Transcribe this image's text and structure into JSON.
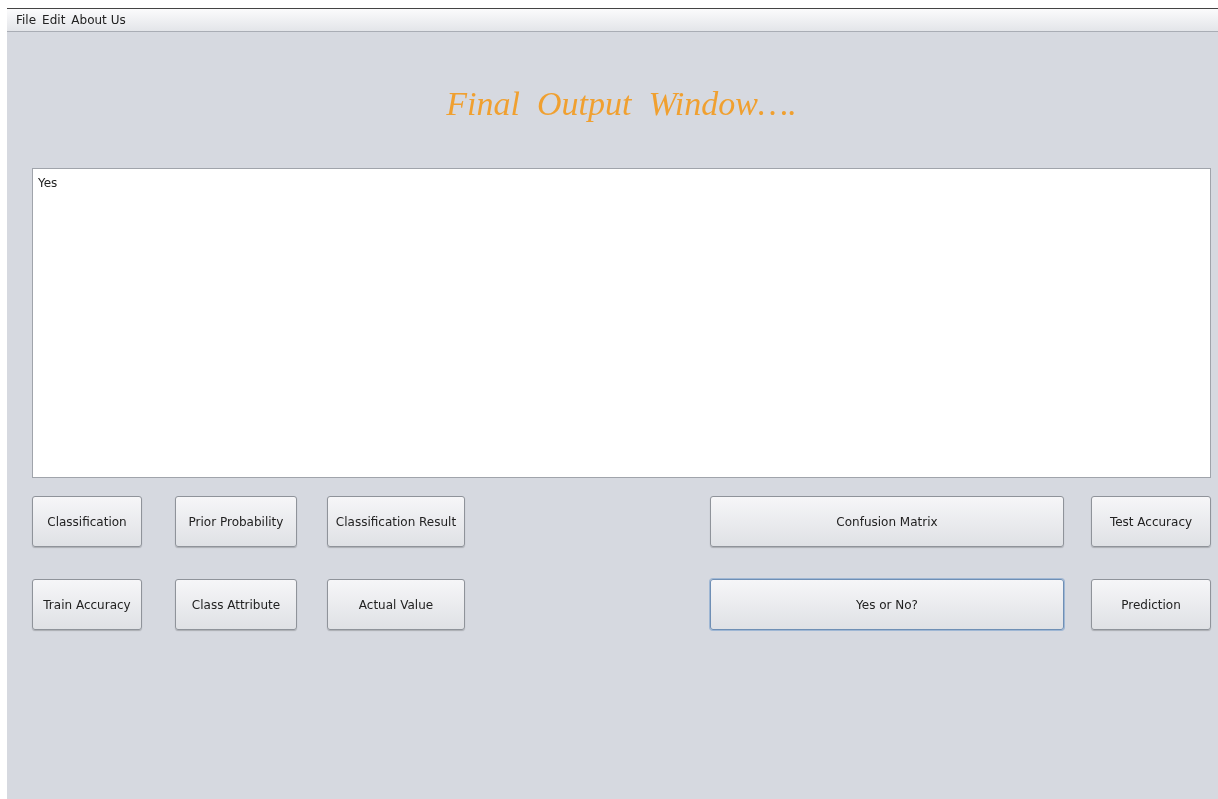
{
  "menu": [
    "File",
    "Edit",
    "About Us"
  ],
  "title": "Final  Output  Window….",
  "output_area": {
    "value": "Yes"
  },
  "buttons": [
    {
      "label": "Classification",
      "focused": false
    },
    {
      "label": "Prior Probability",
      "focused": false
    },
    {
      "label": "Classification Result",
      "focused": false
    },
    {
      "label": "Confusion Matrix",
      "focused": false
    },
    {
      "label": "Test Accuracy",
      "focused": false
    },
    {
      "label": "Train Accuracy",
      "focused": false
    },
    {
      "label": "Class Attribute",
      "focused": false
    },
    {
      "label": "Actual Value",
      "focused": false
    },
    {
      "label": "Yes or No?",
      "focused": true
    },
    {
      "label": "Prediction",
      "focused": false
    }
  ]
}
